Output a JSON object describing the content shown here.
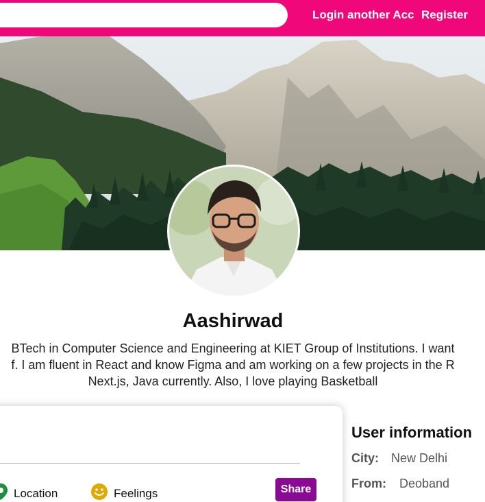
{
  "nav": {
    "search_placeholder": "",
    "login_label": "Login another Acc",
    "register_label": "Register"
  },
  "profile": {
    "name": "Aashirwad",
    "bio_lines": [
      "BTech in Computer Science and Engineering at KIET Group of Institutions. I want",
      "f. I am fluent in React and know Figma and am working on a few projects in the R",
      "Next.js, Java currently. Also, I love playing Basketball"
    ]
  },
  "share": {
    "input_placeholder": "",
    "location_label": "Location",
    "feelings_label": "Feelings",
    "share_button": "Share"
  },
  "user_info": {
    "title": "User information",
    "city_label": "City:",
    "city_value": "New Delhi",
    "from_label": "From:",
    "from_value": "Deoband"
  },
  "colors": {
    "accent": "#f0087a",
    "share_button": "#8b0a93",
    "location_icon": "#1e8e3e",
    "feelings_icon": "#e0a800"
  },
  "icons": {
    "location": "location-pin-icon",
    "feelings": "smiley-face-icon"
  }
}
